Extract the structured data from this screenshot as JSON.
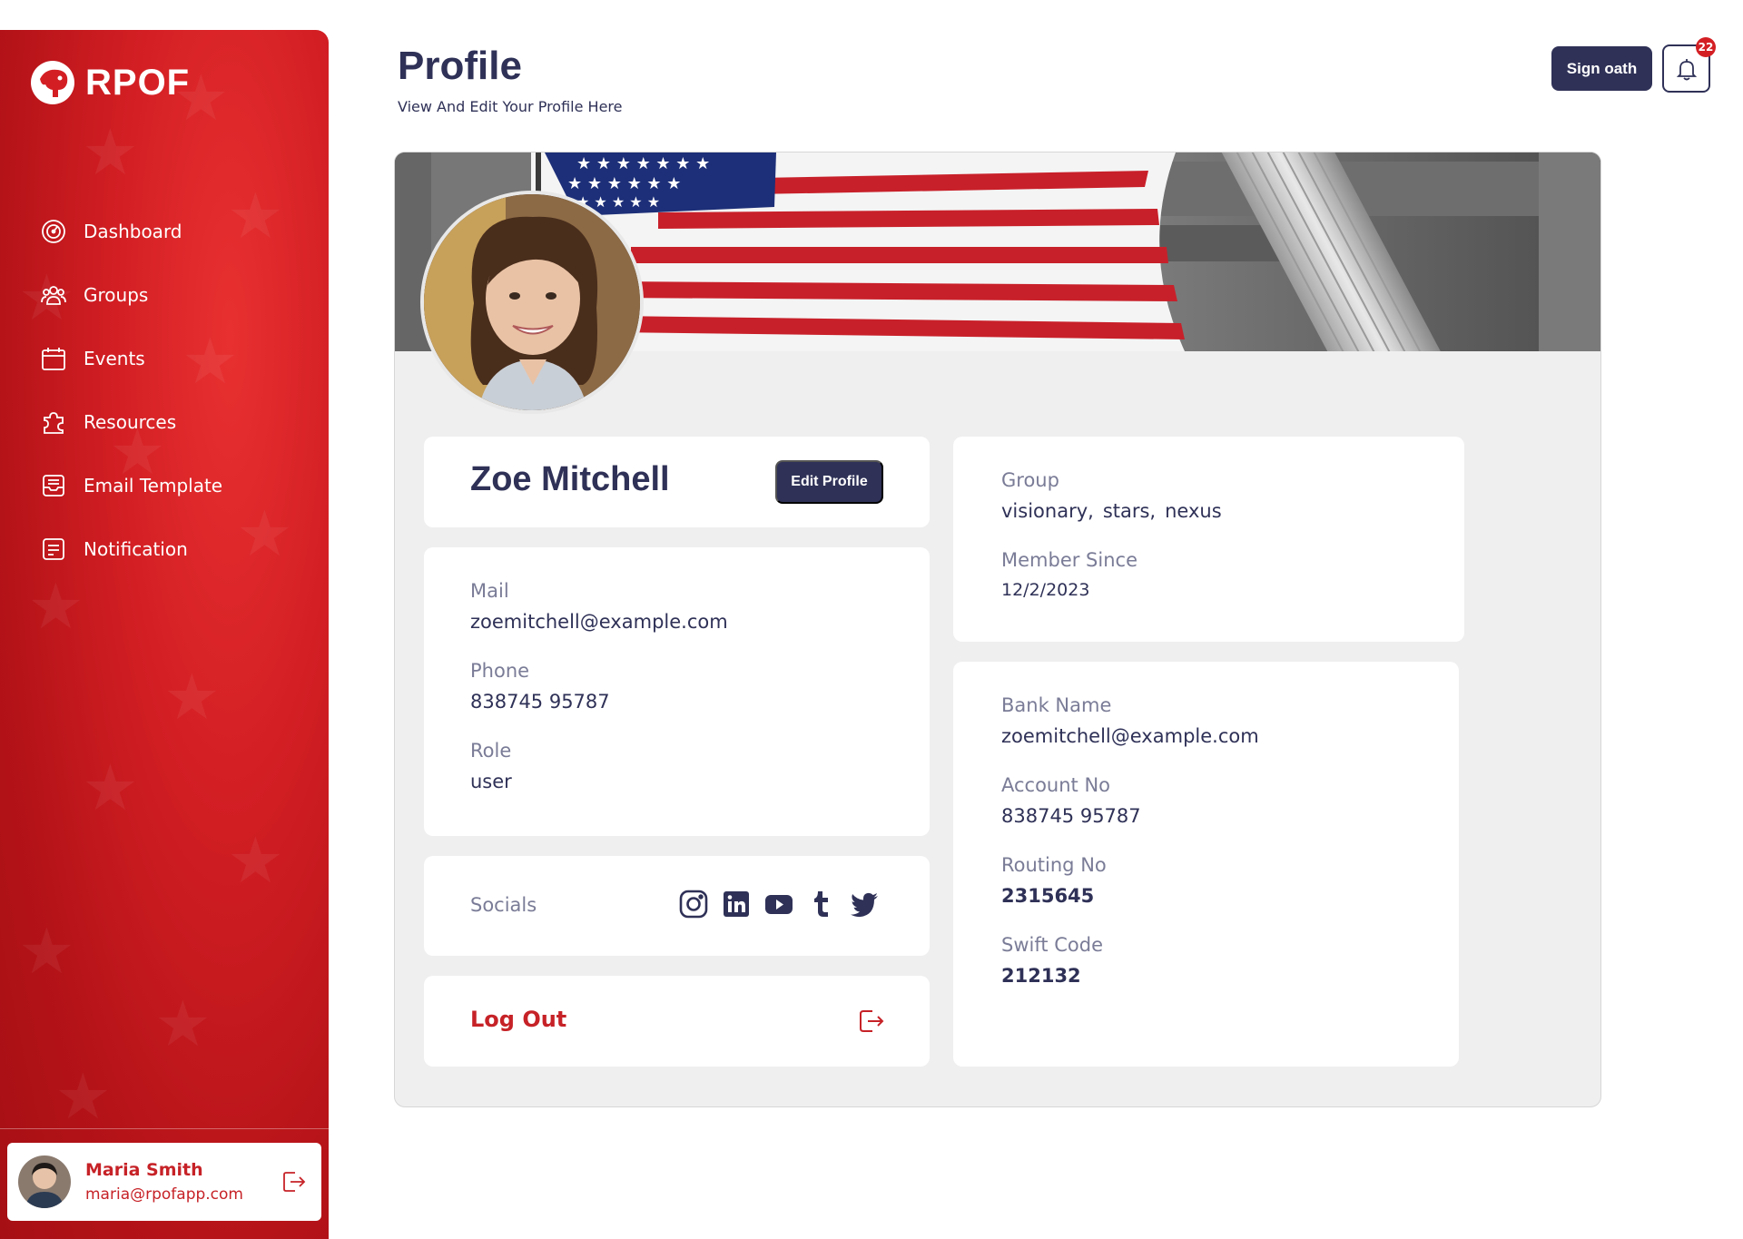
{
  "brand": {
    "name": "RPOF"
  },
  "sidebar": {
    "items": [
      {
        "label": "Dashboard",
        "icon": "dashboard-icon"
      },
      {
        "label": "Groups",
        "icon": "groups-icon"
      },
      {
        "label": "Events",
        "icon": "calendar-icon"
      },
      {
        "label": "Resources",
        "icon": "puzzle-icon"
      },
      {
        "label": "Email Template",
        "icon": "inbox-icon"
      },
      {
        "label": "Notification",
        "icon": "notification-icon"
      }
    ],
    "user": {
      "name": "Maria Smith",
      "email": "maria@rpofapp.com"
    }
  },
  "header": {
    "title": "Profile",
    "subtitle": "View And Edit Your Profile Here",
    "sign_button": "Sign oath",
    "notification_count": "22"
  },
  "profile": {
    "name": "Zoe Mitchell",
    "edit_button": "Edit Profile",
    "mail_label": "Mail",
    "mail": "zoemitchell@example.com",
    "phone_label": "Phone",
    "phone": "838745 95787",
    "role_label": "Role",
    "role": "user",
    "socials_label": "Socials",
    "socials": [
      "instagram-icon",
      "linkedin-icon",
      "youtube-icon",
      "tumblr-icon",
      "twitter-icon"
    ],
    "logout_label": "Log Out",
    "group_label": "Group",
    "groups": [
      "visionary,",
      "stars,",
      "nexus"
    ],
    "member_since_label": "Member Since",
    "member_since": "12/2/2023",
    "bank_name_label": "Bank Name",
    "bank_name": "zoemitchell@example.com",
    "account_label": "Account No",
    "account": "838745 95787",
    "routing_label": "Routing No",
    "routing": "2315645",
    "swift_label": "Swift Code",
    "swift": "212132"
  },
  "colors": {
    "primary": "#2f3157",
    "brand_red": "#d31f24",
    "accent_red": "#c62227",
    "panel_bg": "#efefef"
  }
}
